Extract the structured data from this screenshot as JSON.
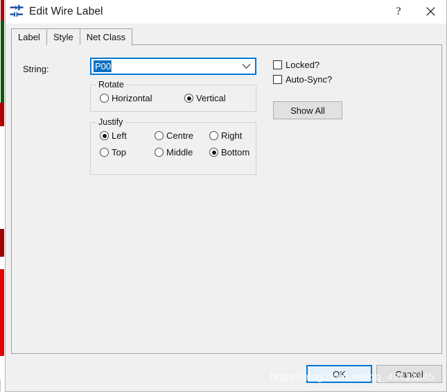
{
  "window": {
    "title": "Edit Wire Label",
    "icon": "wire-label-icon",
    "help_label": "?",
    "close_label": "✕"
  },
  "tabs": [
    {
      "label": "Label",
      "active": true
    },
    {
      "label": "Style",
      "active": false
    },
    {
      "label": "Net Class",
      "active": false
    }
  ],
  "form": {
    "string_label": "String:",
    "string_value": "P00",
    "string_dropdown_icon": "chevron-down-icon"
  },
  "rotate": {
    "title": "Rotate",
    "options": [
      {
        "label": "Horizontal",
        "checked": false
      },
      {
        "label": "Vertical",
        "checked": true
      }
    ]
  },
  "justify": {
    "title": "Justify",
    "options": [
      {
        "label": "Left",
        "checked": true
      },
      {
        "label": "Centre",
        "checked": false
      },
      {
        "label": "Right",
        "checked": false
      },
      {
        "label": "Top",
        "checked": false
      },
      {
        "label": "Middle",
        "checked": false
      },
      {
        "label": "Bottom",
        "checked": true
      }
    ]
  },
  "options_panel": {
    "locked": {
      "label": "Locked?",
      "checked": false
    },
    "auto_sync": {
      "label": "Auto-Sync?",
      "checked": false
    },
    "show_all_label": "Show All"
  },
  "footer": {
    "ok_label": "OK",
    "cancel_label": "Cancel"
  },
  "overlay": {
    "watermark": "https://blog.csdn.net/qq_45413245"
  },
  "colors": {
    "accent": "#0078d7",
    "dialog_bg": "#f0f0f0",
    "selection_bg": "#0a6fc2",
    "button_bg": "#e1e1e1",
    "backdrop_red": "#b00000",
    "backdrop_green": "#0a5c0a"
  }
}
